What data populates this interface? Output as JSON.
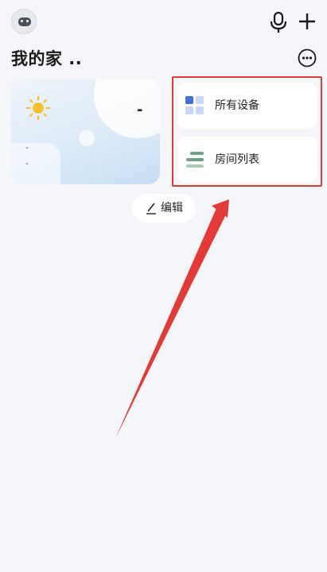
{
  "header": {
    "title": "我的家 ..",
    "avatar_icon": "robot-avatar-icon",
    "mic_icon": "microphone-icon",
    "add_icon": "plus-icon",
    "more_icon": "more-options-icon"
  },
  "weather": {
    "icon": "sun-icon",
    "temperature": "-",
    "line1": "-",
    "line2": "-"
  },
  "quick_access": {
    "items": [
      {
        "label": "所有设备",
        "icon": "all-devices-icon"
      },
      {
        "label": "房间列表",
        "icon": "room-list-icon"
      }
    ],
    "highlight_color": "#e53935"
  },
  "edit": {
    "label": "编辑",
    "icon": "pencil-icon"
  },
  "colors": {
    "background": "#f5f6fa",
    "sun": "#f6c12d",
    "device_icon_blue": "#3f6fd8",
    "room_icon_green": "#6aa386",
    "annotation_red": "#e53935"
  }
}
